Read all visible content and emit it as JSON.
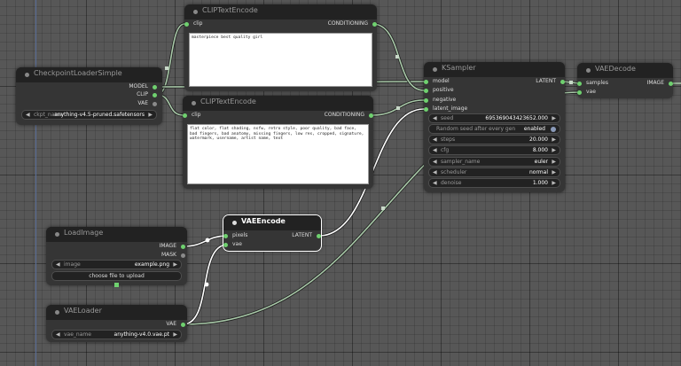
{
  "colors": {
    "accent_pin": "#6fd16f",
    "wire": "#ffffff",
    "wire_shade": "#a8c8a8"
  },
  "nodes": {
    "checkpoint": {
      "title": "CheckpointLoaderSimple",
      "outputs": [
        "MODEL",
        "CLIP",
        "VAE"
      ],
      "ckpt": {
        "name": "ckpt_name",
        "value": "anything-v4.5-pruned.safetensors"
      }
    },
    "clip_top": {
      "title": "CLIPTextEncode",
      "input": "clip",
      "output": "CONDITIONING",
      "text": "masterpiece best quality girl"
    },
    "clip_bottom": {
      "title": "CLIPTextEncode",
      "input": "clip",
      "output": "CONDITIONING",
      "text": "flat color, flat shading, nsfw, retro style, poor quality, bad face, bad fingers, bad anatomy, missing fingers, low res, cropped, signature, watermark, username, artist name, text"
    },
    "ksampler": {
      "title": "KSampler",
      "inputs": [
        "model",
        "positive",
        "negative",
        "latent_image"
      ],
      "output": "LATENT",
      "seed": {
        "name": "seed",
        "value": "695369043423652.000"
      },
      "random": {
        "name": "Random seed after every gen",
        "value": "enabled"
      },
      "steps": {
        "name": "steps",
        "value": "20.000"
      },
      "cfg": {
        "name": "cfg",
        "value": "8.000"
      },
      "sampler": {
        "name": "sampler_name",
        "value": "euler"
      },
      "scheduler": {
        "name": "scheduler",
        "value": "normal"
      },
      "denoise": {
        "name": "denoise",
        "value": "1.000"
      }
    },
    "vaedecode": {
      "title": "VAEDecode",
      "inputs": [
        "samples",
        "vae"
      ],
      "output": "IMAGE"
    },
    "vaeencode": {
      "title": "VAEEncode",
      "inputs": [
        "pixels",
        "vae"
      ],
      "output": "LATENT"
    },
    "loadimage": {
      "title": "LoadImage",
      "outputs": [
        "IMAGE",
        "MASK"
      ],
      "image": {
        "name": "image",
        "value": "example.png"
      },
      "upload": "choose file to upload"
    },
    "vaeloader": {
      "title": "VAELoader",
      "output": "VAE",
      "vae": {
        "name": "vae_name",
        "value": "anything-v4.0.vae.pt"
      }
    }
  }
}
